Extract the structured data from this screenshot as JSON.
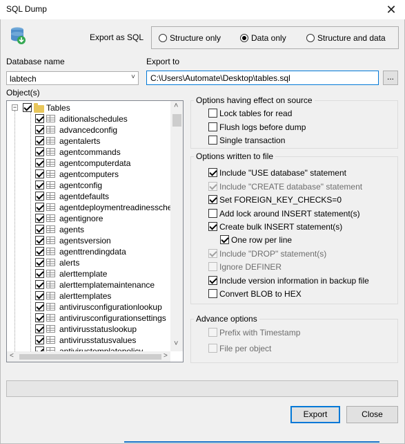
{
  "window": {
    "title": "SQL Dump",
    "close_glyph": "✕"
  },
  "export_as": {
    "label": "Export as SQL",
    "options": [
      {
        "label": "Structure only",
        "selected": false
      },
      {
        "label": "Data only",
        "selected": true
      },
      {
        "label": "Structure and data",
        "selected": false
      }
    ]
  },
  "database": {
    "label": "Database name",
    "value": "labtech"
  },
  "export_to": {
    "label": "Export to",
    "value": "C:\\Users\\Automate\\Desktop\\tables.sql",
    "browse_label": "..."
  },
  "objects": {
    "label": "Object(s)",
    "root": {
      "label": "Tables",
      "checked": true,
      "expander": "−"
    },
    "items": [
      "aditionalschedules",
      "advancedconfig",
      "agentalerts",
      "agentcommands",
      "agentcomputerdata",
      "agentcomputers",
      "agentconfig",
      "agentdefaults",
      "agentdeploymentreadinesscheck",
      "agentignore",
      "agents",
      "agentsversion",
      "agenttrendingdata",
      "alerts",
      "alerttemplate",
      "alerttemplatemaintenance",
      "alerttemplates",
      "antivirusconfigurationlookup",
      "antivirusconfigurationsettings",
      "antivirusstatuslookup",
      "antivirusstatusvalues",
      "antivirustemplatepolicy"
    ]
  },
  "source_options": {
    "title": "Options having effect on source",
    "items": [
      {
        "label": "Lock tables for read",
        "checked": false,
        "enabled": true
      },
      {
        "label": "Flush logs before dump",
        "checked": false,
        "enabled": true
      },
      {
        "label": "Single transaction",
        "checked": false,
        "enabled": true
      }
    ]
  },
  "file_options": {
    "title": "Options written to file",
    "items": [
      {
        "label": "Include \"USE database\" statement",
        "checked": true,
        "enabled": true
      },
      {
        "label": "Include \"CREATE database\" statement",
        "checked": true,
        "enabled": false
      },
      {
        "label": "Set FOREIGN_KEY_CHECKS=0",
        "checked": true,
        "enabled": true
      },
      {
        "label": "Add lock around INSERT statement(s)",
        "checked": false,
        "enabled": true
      },
      {
        "label": "Create bulk INSERT statement(s)",
        "checked": true,
        "enabled": true
      },
      {
        "label": "One row per line",
        "checked": true,
        "enabled": true
      },
      {
        "label": "Include \"DROP\" statement(s)",
        "checked": true,
        "enabled": false
      },
      {
        "label": "Ignore DEFINER",
        "checked": false,
        "enabled": false
      },
      {
        "label": "Include version information in backup file",
        "checked": true,
        "enabled": true
      },
      {
        "label": "Convert BLOB to HEX",
        "checked": false,
        "enabled": true
      }
    ]
  },
  "advance_options": {
    "title": "Advance options",
    "items": [
      {
        "label": "Prefix with Timestamp",
        "checked": false,
        "enabled": false
      },
      {
        "label": "File per object",
        "checked": false,
        "enabled": false
      }
    ]
  },
  "buttons": {
    "export": "Export",
    "close": "Close"
  },
  "scroll": {
    "up_glyph": "˄",
    "down_glyph": "˅",
    "left_glyph": "<",
    "right_glyph": ">"
  },
  "progress": {
    "value": 0
  }
}
